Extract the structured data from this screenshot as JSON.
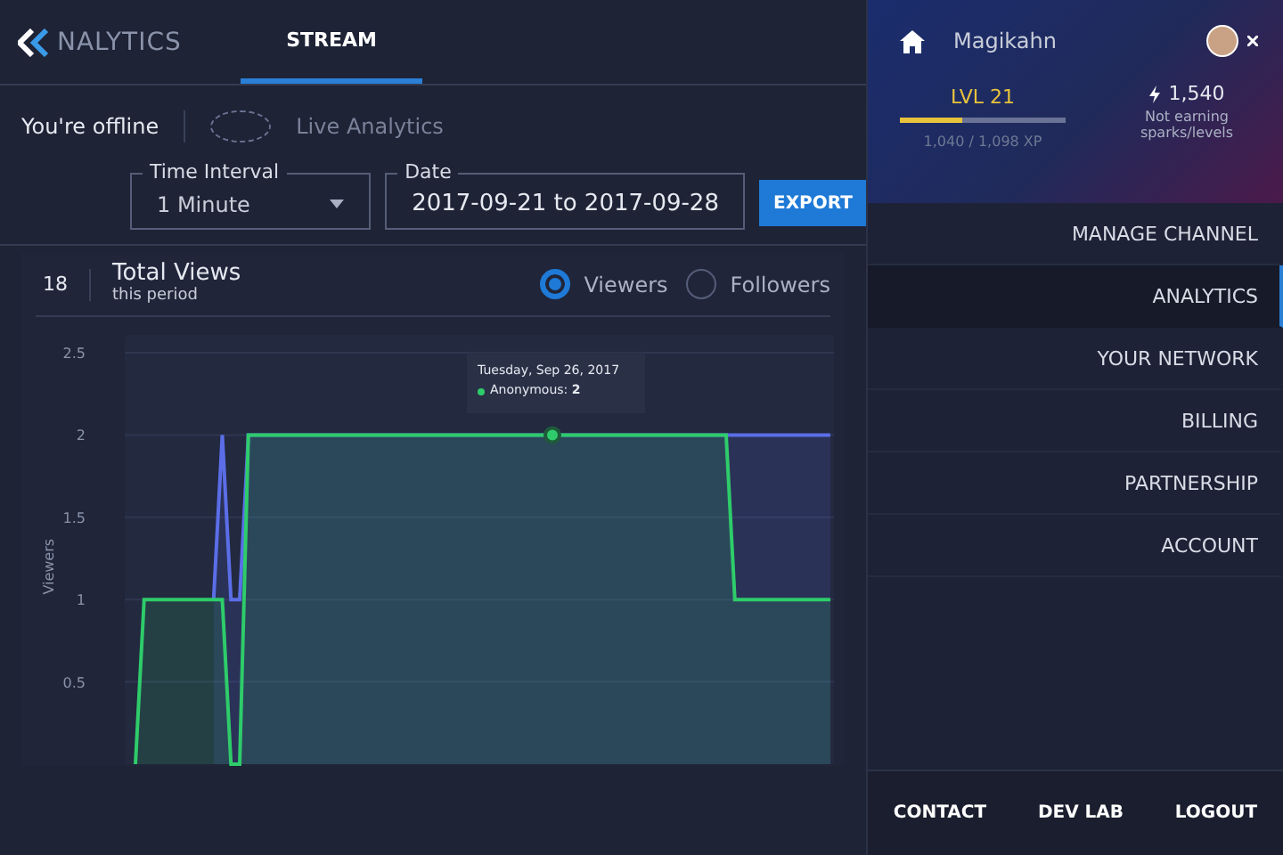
{
  "header": {
    "logo_text": "NALYTICS",
    "tabs": [
      {
        "label": "STREAM",
        "selected": true
      }
    ]
  },
  "status": {
    "text": "You're offline",
    "live_label": "Live Analytics"
  },
  "filters": {
    "interval": {
      "label": "Time Interval",
      "value": "1 Minute"
    },
    "date": {
      "label": "Date",
      "value": "2017-09-21 to 2017-09-28"
    },
    "export_button": "EXPORT"
  },
  "stats": {
    "count": "18",
    "title": "Total Views",
    "subtitle": "this period",
    "options": [
      {
        "label": "Viewers",
        "selected": true
      },
      {
        "label": "Followers",
        "selected": false
      }
    ]
  },
  "chart_data": {
    "type": "area",
    "ylabel": "Viewers",
    "categories": [
      null,
      null,
      null,
      null,
      null,
      null,
      null,
      null,
      null,
      null,
      null,
      null,
      null,
      null,
      null,
      null,
      null,
      null,
      null,
      null,
      null,
      null,
      null,
      null,
      null,
      null,
      null,
      null,
      null,
      null,
      null,
      null,
      null,
      null,
      null,
      null,
      null,
      null,
      null,
      null,
      null,
      null,
      null,
      null,
      null,
      null,
      null,
      null,
      null,
      null,
      null,
      null,
      null,
      null,
      null,
      null,
      null,
      null,
      null,
      null,
      null,
      null,
      null,
      null,
      null,
      null,
      null,
      null,
      null,
      null,
      null,
      null,
      null,
      null,
      null,
      null,
      null,
      null,
      null,
      null,
      null
    ],
    "ylim": [
      0,
      2.5
    ],
    "grid": true,
    "yticks": [
      0.5,
      1,
      1.5,
      2,
      2.5
    ],
    "series": [
      {
        "color": "#5b6ee8",
        "values": [
          null,
          null,
          null,
          null,
          null,
          null,
          null,
          null,
          null,
          1,
          2,
          1,
          1,
          2,
          2,
          2,
          2,
          2,
          2,
          2,
          2,
          2,
          2,
          2,
          2,
          2,
          2,
          2,
          2,
          2,
          2,
          2,
          2,
          2,
          2,
          2,
          2,
          2,
          2,
          2,
          2,
          2,
          2,
          2,
          2,
          2,
          2,
          2,
          2,
          2,
          2,
          2,
          2,
          2,
          2,
          2,
          2,
          2,
          2,
          2,
          2,
          2,
          2,
          2,
          2,
          2,
          2,
          2,
          2,
          2,
          2,
          2,
          2,
          2,
          2,
          2,
          2,
          2,
          2,
          2,
          2
        ]
      },
      {
        "name": "Anonymous",
        "color": "#2ecc6a",
        "values": [
          0,
          1,
          1,
          1,
          1,
          1,
          1,
          1,
          1,
          1,
          1,
          0,
          0,
          2,
          2,
          2,
          2,
          2,
          2,
          2,
          2,
          2,
          2,
          2,
          2,
          2,
          2,
          2,
          2,
          2,
          2,
          2,
          2,
          2,
          2,
          2,
          2,
          2,
          2,
          2,
          2,
          2,
          2,
          2,
          2,
          2,
          2,
          2,
          2,
          2,
          2,
          2,
          2,
          2,
          2,
          2,
          2,
          2,
          2,
          2,
          2,
          2,
          2,
          2,
          2,
          2,
          2,
          2,
          2,
          1,
          1,
          1,
          1,
          1,
          1,
          1,
          1,
          1,
          1,
          1,
          1
        ]
      }
    ],
    "annotations": [
      "Tuesday, Sep 26, 2017"
    ]
  },
  "tooltip": {
    "separator": ":",
    "value": "2"
  },
  "profile": {
    "username": "Magikahn",
    "level_label": "LVL 21",
    "level": 0.38,
    "xp": "1,040 / 1,098 XP",
    "sparks": "1,540",
    "sparks_note": "Not earning sparks/levels"
  },
  "nav": [
    {
      "label": "MANAGE CHANNEL",
      "selected": false
    },
    {
      "label": "ANALYTICS",
      "selected": true
    },
    {
      "label": "YOUR NETWORK",
      "selected": false
    },
    {
      "label": "BILLING",
      "selected": false
    },
    {
      "label": "PARTNERSHIP",
      "selected": false
    },
    {
      "label": "ACCOUNT",
      "selected": false
    }
  ],
  "footer": [
    "CONTACT",
    "DEV LAB",
    "LOGOUT"
  ]
}
